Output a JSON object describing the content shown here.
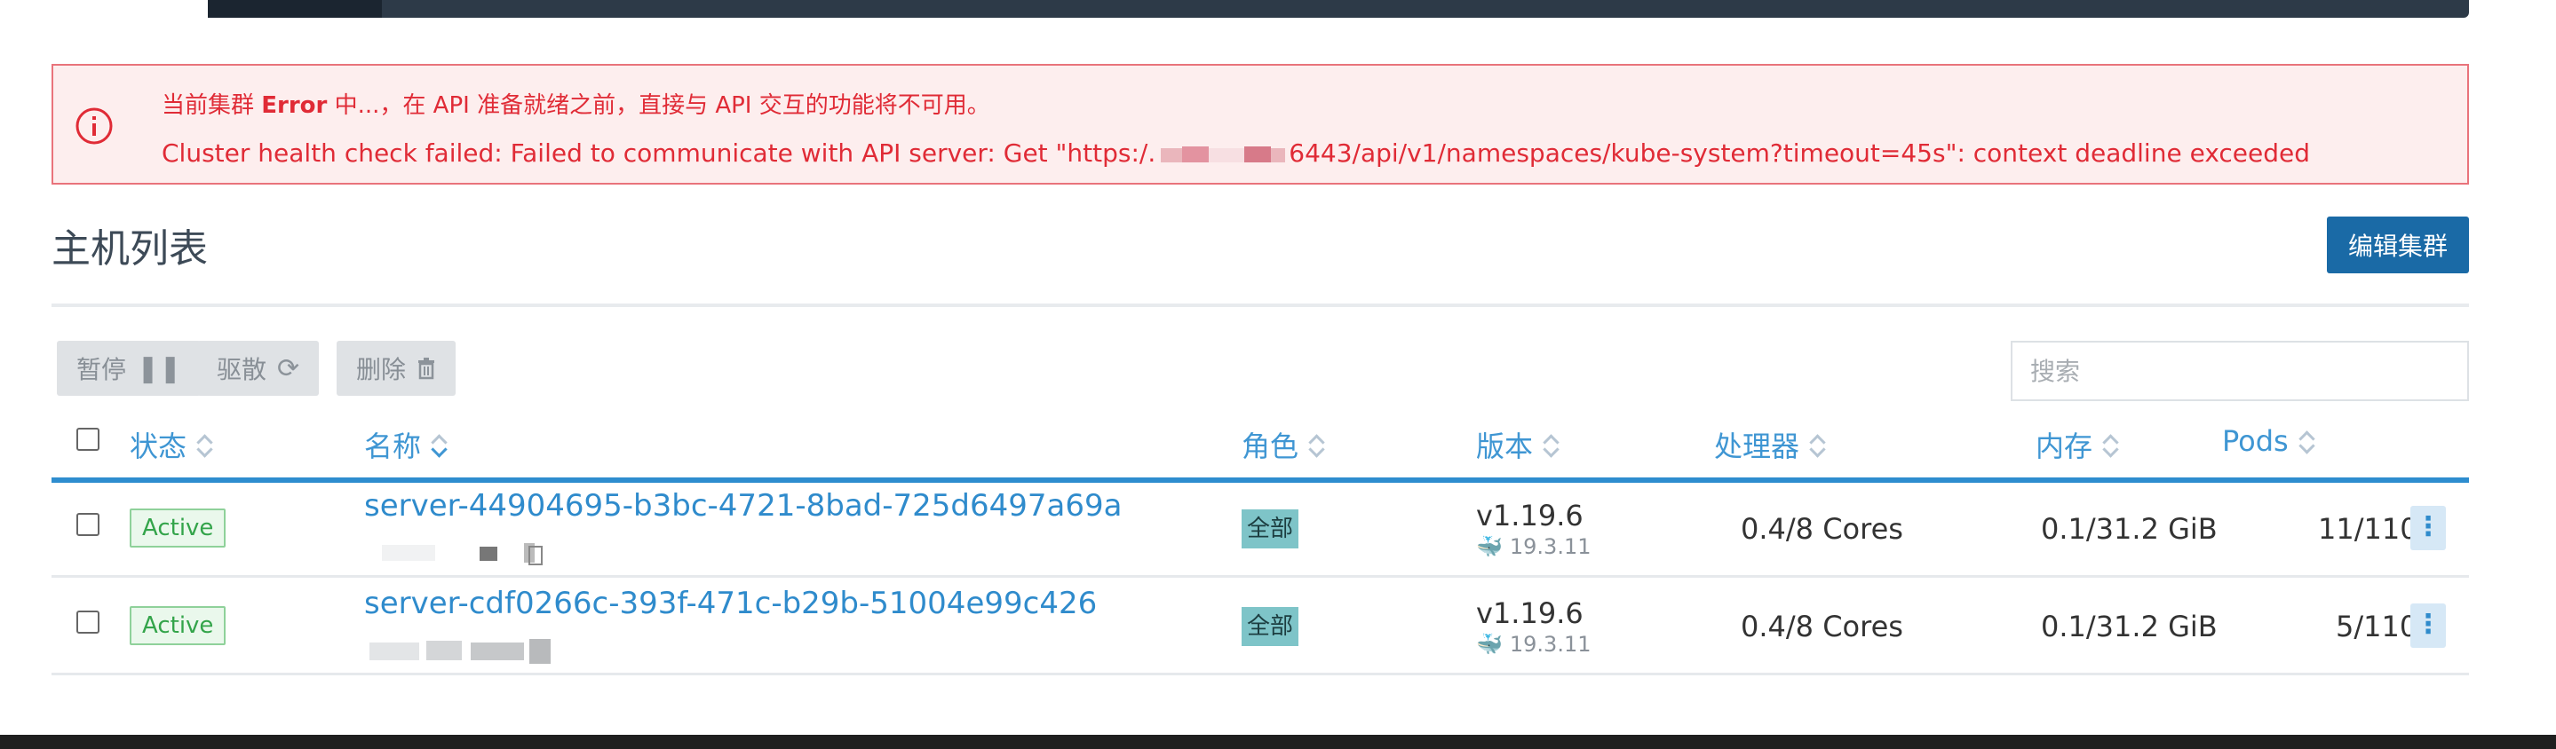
{
  "banner": {
    "line1_prefix": "当前集群 ",
    "line1_bold": "Error",
    "line1_suffix": " 中...，在 API 准备就绪之前，直接与 API 交互的功能将不可用。",
    "line2_prefix": "Cluster health check failed: Failed to communicate with API server: Get \"https:/.",
    "line2_suffix": "6443/api/v1/namespaces/kube-system?timeout=45s\": context deadline exceeded",
    "icon": "info-circle-icon"
  },
  "page": {
    "title": "主机列表",
    "edit_button": "编辑集群"
  },
  "toolbar": {
    "pause": "暂停",
    "pause_icon": "pause-icon",
    "drain": "驱散",
    "drain_icon": "refresh-icon",
    "delete": "删除",
    "delete_icon": "trash-icon",
    "search_placeholder": "搜索"
  },
  "columns": {
    "state": "状态",
    "name": "名称",
    "role": "角色",
    "version": "版本",
    "cpu": "处理器",
    "memory": "内存",
    "pods": "Pods"
  },
  "rows": [
    {
      "state": "Active",
      "name": "server-44904695-b3bc-4721-8bad-725d6497a69a",
      "role": "全部",
      "version": "v1.19.6",
      "docker": "19.3.11",
      "cpu": "0.4/8 Cores",
      "memory": "0.1/31.2 GiB",
      "pods": "11/110"
    },
    {
      "state": "Active",
      "name": "server-cdf0266c-393f-471c-b29b-51004e99c426",
      "role": "全部",
      "version": "v1.19.6",
      "docker": "19.3.11",
      "cpu": "0.4/8 Cores",
      "memory": "0.1/31.2 GiB",
      "pods": "5/110"
    }
  ],
  "colors": {
    "accent": "#2f8bcc",
    "error": "#e02b36",
    "active": "#33a44a",
    "button": "#1a6aa6"
  }
}
